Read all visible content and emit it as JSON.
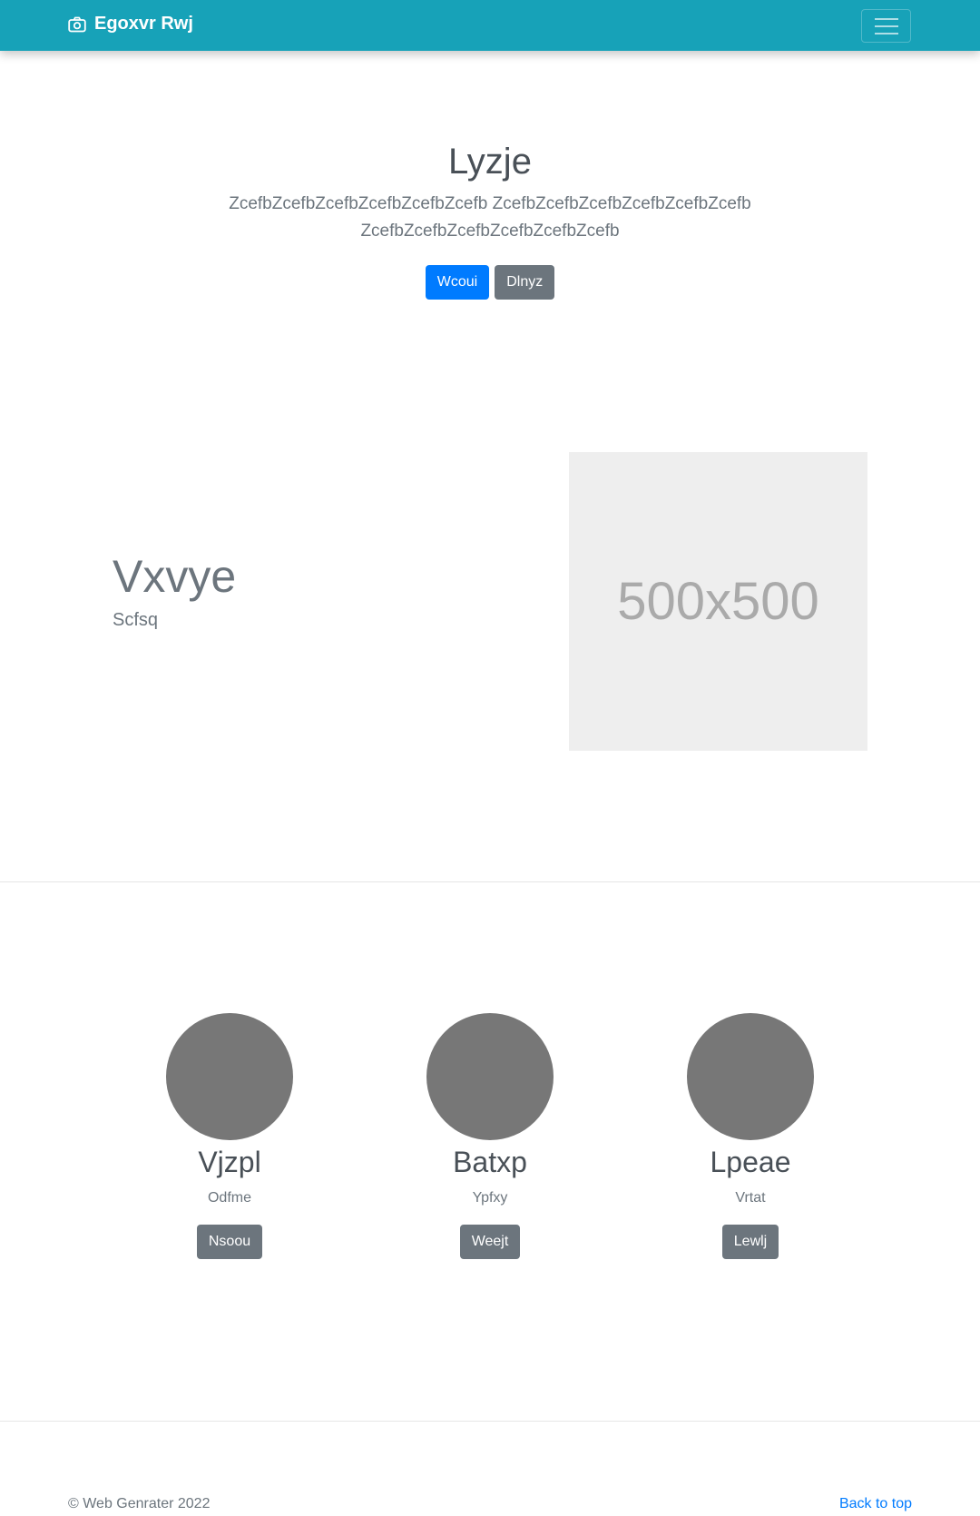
{
  "navbar": {
    "brand_icon": "camera-icon",
    "brand": "Egoxvr Rwj",
    "toggler_icon": "hamburger-icon"
  },
  "hero": {
    "title": "Lyzje",
    "lead": "ZcefbZcefbZcefbZcefbZcefbZcefb ZcefbZcefbZcefbZcefbZcefbZcefb ZcefbZcefbZcefbZcefbZcefbZcefb",
    "primary_button": "Wcoui",
    "secondary_button": "Dlnyz"
  },
  "feature": {
    "heading": "Vxvye",
    "subheading": "Scfsq",
    "image_placeholder": "500x500"
  },
  "columns": [
    {
      "title": "Vjzpl",
      "text": "Odfme",
      "button": "Nsoou"
    },
    {
      "title": "Batxp",
      "text": "Ypfxy",
      "button": "Weejt"
    },
    {
      "title": "Lpeae",
      "text": "Vrtat",
      "button": "Lewlj"
    }
  ],
  "footer": {
    "copyright": "© Web Genrater 2022",
    "back_to_top": "Back to top"
  },
  "colors": {
    "navbar": "#17a2b8",
    "primary": "#007bff",
    "secondary": "#6c757d",
    "avatar": "#777777",
    "placeholder": "#eeeeee"
  }
}
